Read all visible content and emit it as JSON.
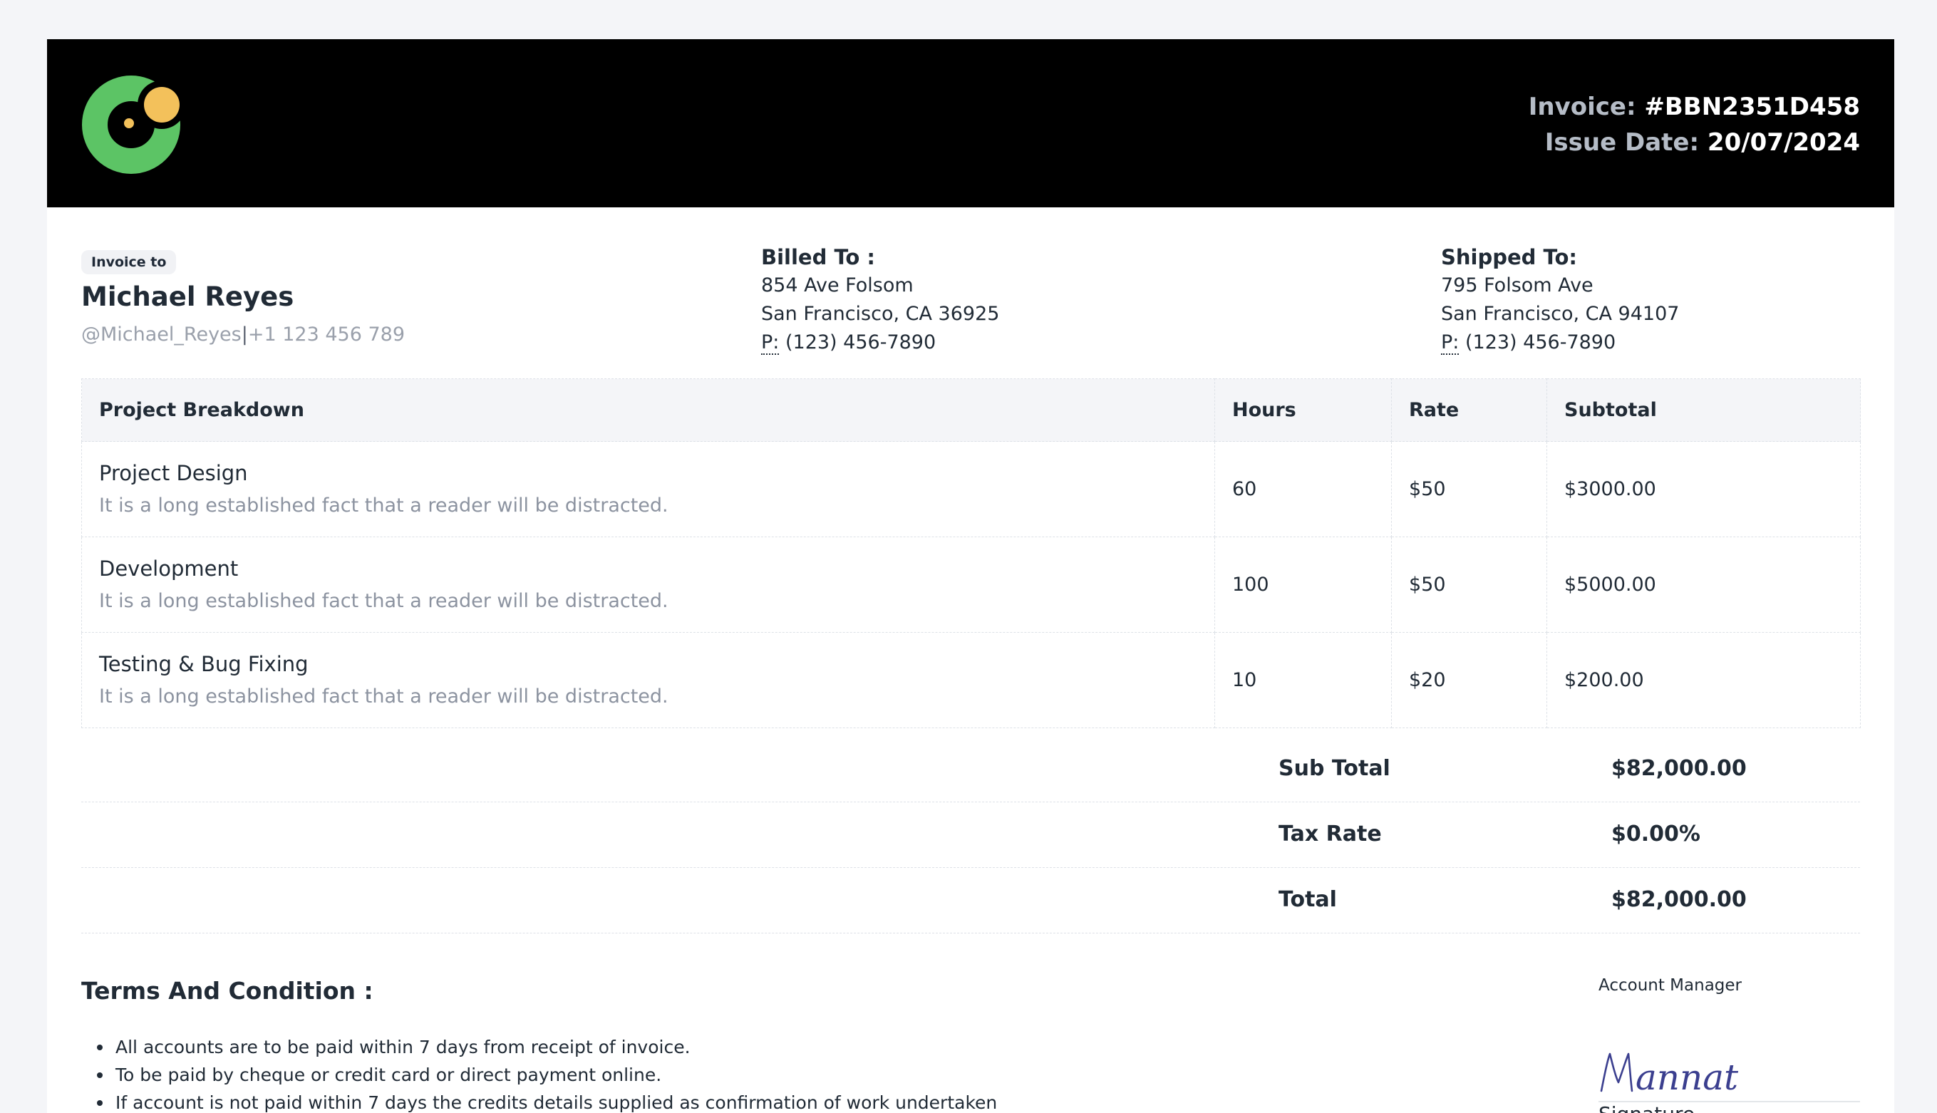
{
  "header": {
    "invoice_label": "Invoice:",
    "invoice_number": "#BBN2351D458",
    "issue_label": "Issue Date:",
    "issue_date": "20/07/2024"
  },
  "client": {
    "badge": "Invoice to",
    "name": "Michael Reyes",
    "handle": "@Michael_Reyes",
    "separator": "|",
    "phone": "+1 123 456 789"
  },
  "billed_to": {
    "title": "Billed To :",
    "line1": "854 Ave Folsom",
    "line2": "San Francisco, CA 36925",
    "phone_label": "P:",
    "phone": "(123) 456-7890"
  },
  "shipped_to": {
    "title": "Shipped To:",
    "line1": "795 Folsom Ave",
    "line2": "San Francisco, CA 94107",
    "phone_label": "P:",
    "phone": "(123) 456-7890"
  },
  "table": {
    "headers": [
      "Project Breakdown",
      "Hours",
      "Rate",
      "Subtotal"
    ],
    "rows": [
      {
        "name": "Project Design",
        "desc": "It is a long established fact that a reader will be distracted.",
        "hours": "60",
        "rate": "$50",
        "subtotal": "$3000.00"
      },
      {
        "name": "Development",
        "desc": "It is a long established fact that a reader will be distracted.",
        "hours": "100",
        "rate": "$50",
        "subtotal": "$5000.00"
      },
      {
        "name": "Testing & Bug Fixing",
        "desc": "It is a long established fact that a reader will be distracted.",
        "hours": "10",
        "rate": "$20",
        "subtotal": "$200.00"
      }
    ]
  },
  "totals": {
    "subtotal_label": "Sub Total",
    "subtotal_value": "$82,000.00",
    "tax_label": "Tax Rate",
    "tax_value": "$0.00%",
    "total_label": "Total",
    "total_value": "$82,000.00"
  },
  "terms": {
    "title": "Terms And Condition :",
    "items": [
      "All accounts are to be paid within 7 days from receipt of invoice.",
      "To be paid by cheque or credit card or direct payment online.",
      "If account is not paid within 7 days the credits details supplied as confirmation of work undertaken"
    ]
  },
  "signature": {
    "role": "Account Manager",
    "handwritten": "Mannat",
    "label": "Signature"
  },
  "colors": {
    "header_bg": "#000000",
    "logo_green": "#5cc465",
    "logo_yellow": "#f3c15b",
    "signature_ink": "#3b3f8f"
  },
  "icons": {
    "logo": "company-logo-icon"
  }
}
